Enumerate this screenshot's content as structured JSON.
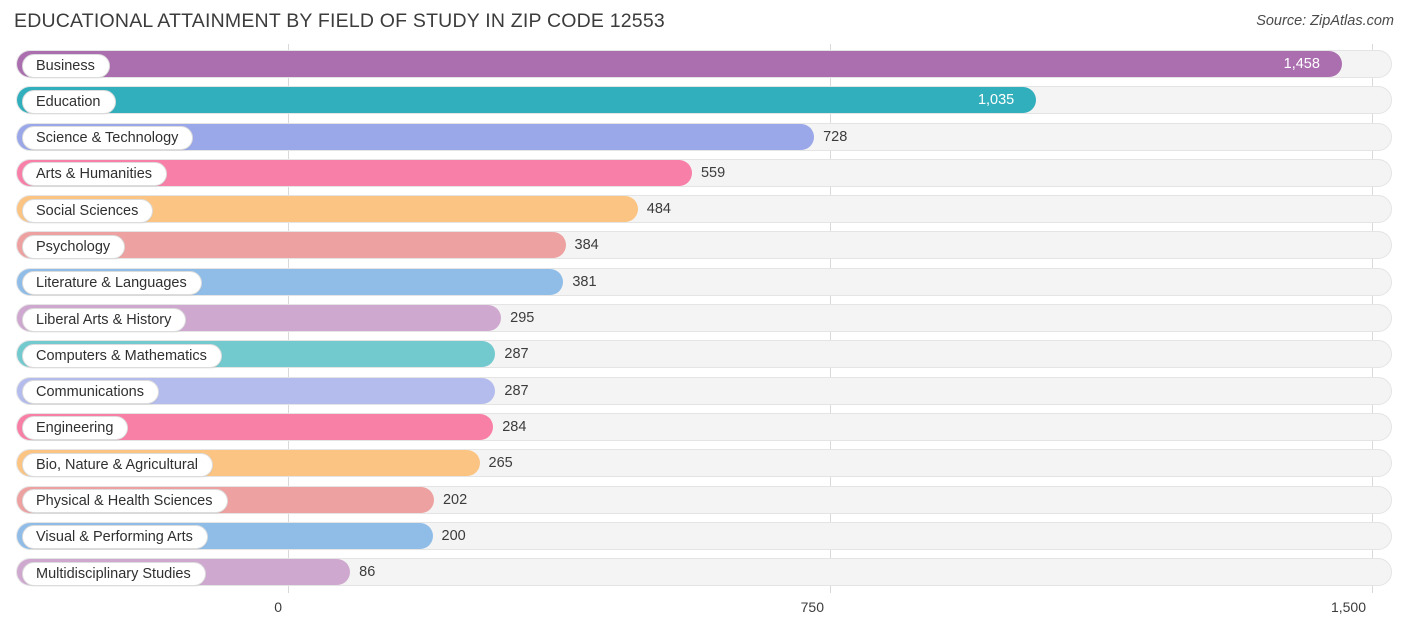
{
  "header": {
    "title": "EDUCATIONAL ATTAINMENT BY FIELD OF STUDY IN ZIP CODE 12553",
    "source": "Source: ZipAtlas.com"
  },
  "chart_data": {
    "type": "bar",
    "orientation": "horizontal",
    "title": "EDUCATIONAL ATTAINMENT BY FIELD OF STUDY IN ZIP CODE 12553",
    "subtitle": "",
    "xlabel": "",
    "ylabel": "",
    "xlim": [
      0,
      1500
    ],
    "grid": true,
    "legend": "none",
    "xticks": [
      "0",
      "750",
      "1,500"
    ],
    "xtick_values": [
      0,
      750,
      1500
    ],
    "categories": [
      "Business",
      "Education",
      "Science & Technology",
      "Arts & Humanities",
      "Social Sciences",
      "Psychology",
      "Literature & Languages",
      "Liberal Arts & History",
      "Computers & Mathematics",
      "Communications",
      "Engineering",
      "Bio, Nature & Agricultural",
      "Physical & Health Sciences",
      "Visual & Performing Arts",
      "Multidisciplinary Studies"
    ],
    "values": [
      1458,
      1035,
      728,
      559,
      484,
      384,
      381,
      295,
      287,
      287,
      284,
      265,
      202,
      200,
      86
    ],
    "value_labels": [
      "1,458",
      "1,035",
      "728",
      "559",
      "484",
      "384",
      "381",
      "295",
      "287",
      "287",
      "284",
      "265",
      "202",
      "200",
      "86"
    ],
    "colors": [
      "#ab6fb0",
      "#32afbc",
      "#9aa7e8",
      "#f77fa8",
      "#fbc483",
      "#eda1a0",
      "#8fbde8",
      "#cfa8cf",
      "#72c9ce",
      "#b3bcec",
      "#f87fa6",
      "#fbc483",
      "#eda1a0",
      "#8fbde8",
      "#cfa8cf"
    ],
    "label_inside": [
      true,
      true,
      false,
      false,
      false,
      false,
      false,
      false,
      false,
      false,
      false,
      false,
      false,
      false,
      false
    ]
  }
}
